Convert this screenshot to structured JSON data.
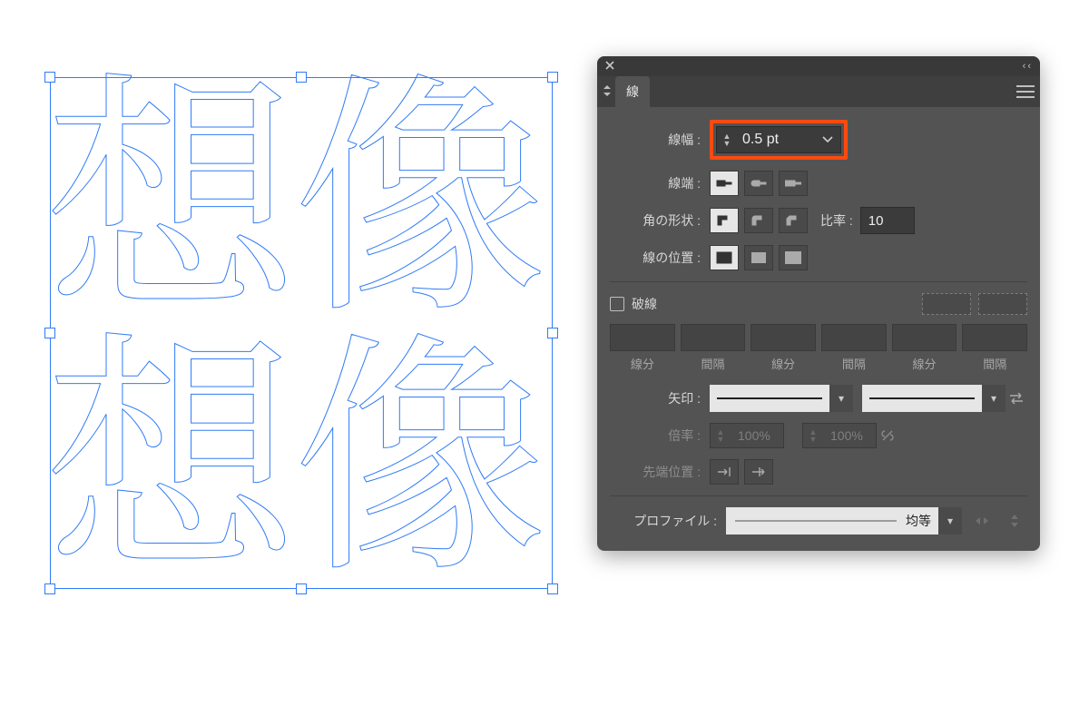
{
  "canvas": {
    "text_row1": "想像",
    "text_row2": "想像"
  },
  "panel": {
    "tab_title": "線",
    "stroke_width": {
      "label": "線幅 :",
      "value": "0.5 pt"
    },
    "cap": {
      "label": "線端 :"
    },
    "corner": {
      "label": "角の形状 :",
      "ratio_label": "比率 :",
      "ratio_value": "10"
    },
    "align": {
      "label": "線の位置 :"
    },
    "dashed": {
      "label": "破線",
      "cols": [
        "線分",
        "間隔",
        "線分",
        "間隔",
        "線分",
        "間隔"
      ]
    },
    "arrow": {
      "label": "矢印 :"
    },
    "scale": {
      "label": "倍率 :",
      "value_left": "100%",
      "value_right": "100%"
    },
    "tip_align": {
      "label": "先端位置 :"
    },
    "profile": {
      "label": "プロファイル :",
      "name": "均等"
    }
  }
}
